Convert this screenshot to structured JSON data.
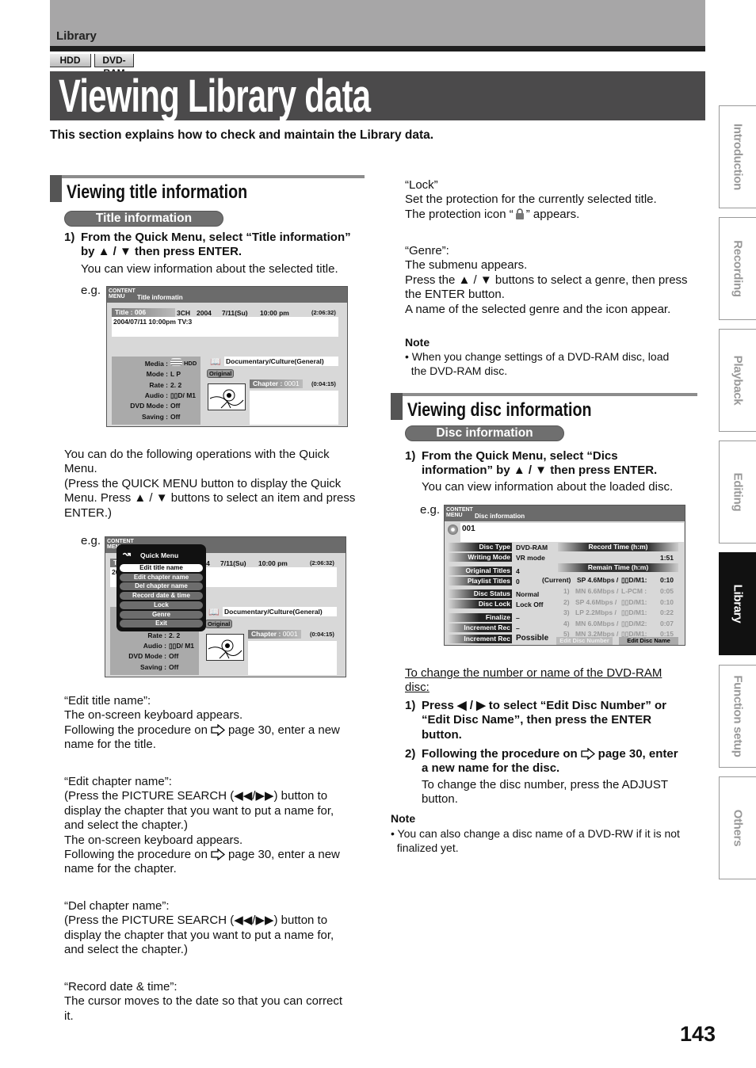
{
  "header": {
    "section": "Library",
    "badges": [
      "HDD",
      "DVD-RAM"
    ],
    "title": "Viewing Library data",
    "intro": "This section explains how to check and maintain the Library data."
  },
  "side_tabs": [
    "Introduction",
    "Recording",
    "Playback",
    "Editing",
    "Library",
    "Function setup",
    "Others"
  ],
  "active_tab": "Library",
  "page_number": "143",
  "left": {
    "section_title": "Viewing title information",
    "pill": "Title information",
    "step1": {
      "num": "1)",
      "lines": [
        "From the Quick Menu, select “Title information”",
        "by ▲ / ▼ then press ENTER."
      ]
    },
    "step1_desc": "You can view information about the selected title.",
    "eg": "e.g.",
    "quick_para": [
      "You can do the following operations with the Quick",
      "Menu.",
      "(Press the QUICK MENU button to display the Quick",
      "Menu. Press ▲ / ▼ buttons to select an item and press",
      "ENTER.)"
    ],
    "eg2": "e.g.",
    "edit_title": [
      "“Edit title name”:",
      "The on-screen keyboard appears.",
      [
        "Following the procedure on",
        "page 30, enter a new"
      ],
      "name for the title."
    ],
    "edit_chapter": [
      "“Edit chapter name”:",
      "(Press the PICTURE SEARCH (◀◀/▶▶) button to",
      "display the chapter that you want to put a name for,",
      "and select the chapter.)",
      "The on-screen keyboard appears.",
      [
        "Following the procedure on",
        "page 30, enter a new"
      ],
      "name for the chapter."
    ],
    "del_chapter": [
      "“Del chapter name”:",
      "(Press the PICTURE SEARCH (◀◀/▶▶) button to",
      "display the chapter that you want to put a name for,",
      "and select the chapter.)"
    ],
    "record_date": [
      "“Record date & time”:",
      "The cursor moves to the date so that you can correct",
      "it."
    ]
  },
  "screen1": {
    "logo": [
      "CONTENT",
      "MENU"
    ],
    "header": "Title informatin",
    "title_label": "Title : 006",
    "channel": "3CH",
    "year": "2004",
    "date": "7/11(Su)",
    "time": "10:00 pm",
    "duration": "(2:06:32)",
    "title_name": "2004/07/11  10:00pm  TV:3",
    "info": [
      {
        "label": "Media :",
        "value": "HDD"
      },
      {
        "label": "Mode :",
        "value": "L P"
      },
      {
        "label": "Rate :",
        "value": "2. 2"
      },
      {
        "label": "Audio :",
        "value": "▯▯D/ M1"
      },
      {
        "label": "DVD Mode :",
        "value": "Off"
      },
      {
        "label": "Saving :",
        "value": "Off"
      }
    ],
    "genre": "Documentary/Culture(General)",
    "original": "Original",
    "chapter_label": "Chapter :",
    "chapter_num": "0001",
    "chapter_time": "(0:04:15)"
  },
  "quick_menu": {
    "title": "Quick Menu",
    "items": [
      "Edit title name",
      "Edit chapter name",
      "Del chapter name",
      "Record date & time",
      "Lock",
      "Genre",
      "Exit"
    ],
    "selected": "Edit title name"
  },
  "right": {
    "lock": [
      "“Lock”",
      "Set the protection for the currently selected title.",
      [
        "The protection icon “",
        "” appears."
      ]
    ],
    "genre": [
      "“Genre”:",
      "The submenu appears.",
      "Press the ▲ / ▼ buttons to select a genre, then press",
      "the ENTER button.",
      "A name of the selected genre and the icon appear."
    ],
    "note1_title": "Note",
    "note1": [
      "• When you change settings of a DVD-RAM disc, load",
      "  the DVD-RAM disc."
    ],
    "section_title": "Viewing disc information",
    "pill": "Disc information",
    "step1": {
      "num": "1)",
      "lines": [
        "From the Quick Menu, select “Dics",
        "information” by ▲ / ▼ then press ENTER."
      ]
    },
    "step1_desc": "You can view information about the loaded disc.",
    "eg": "e.g.",
    "change_heading": [
      "To change the number or name of the DVD-RAM",
      "disc:"
    ],
    "step_a": {
      "num": "1)",
      "lines": [
        "Press ◀ / ▶ to select “Edit Disc Number” or",
        "“Edit Disc Name”, then press the ENTER",
        "button."
      ]
    },
    "step_b": {
      "num": "2)",
      "lines": [
        [
          "Following the procedure on",
          "page 30, enter"
        ],
        "a new name for the disc."
      ]
    },
    "step_b_desc": [
      "To change the disc number, press the ADJUST",
      "button."
    ],
    "note2_title": "Note",
    "note2": [
      "• You can also change a disc name of a DVD-RW if it is not",
      "  finalized yet."
    ]
  },
  "screen3": {
    "logo": [
      "CONTENT",
      "MENU"
    ],
    "header": "Disc information",
    "disc_num": "001",
    "labels": [
      "Disc Type",
      "Writing Mode",
      "Original Titles",
      "Playlist Titles",
      "Disc Status",
      "Disc Lock",
      "Finalize",
      "Increment Rec",
      "Increment Rec"
    ],
    "values": [
      "DVD-RAM",
      "VR mode",
      "4",
      "0",
      "Normal",
      "Lock Off",
      "–",
      "–",
      "Possible"
    ],
    "record_time_label": "Record Time (h:m)",
    "record_time": "1:51",
    "remain_label": "Remain Time (h:m)",
    "current": {
      "tag": "(Current)",
      "rate": "SP 4.6Mbps /",
      "audio": "▯▯D/M1:",
      "time": "0:10"
    },
    "modes": [
      {
        "n": "1)",
        "rate": "MN 6.6Mbps /",
        "audio": "L-PCM  :",
        "time": "0:05"
      },
      {
        "n": "2)",
        "rate": "SP 4.6Mbps /",
        "audio": "▯▯D/M1:",
        "time": "0:10"
      },
      {
        "n": "3)",
        "rate": "LP 2.2Mbps /",
        "audio": "▯▯D/M1:",
        "time": "0:22"
      },
      {
        "n": "4)",
        "rate": "MN 6.0Mbps /",
        "audio": "▯▯D/M2:",
        "time": "0:07"
      },
      {
        "n": "5)",
        "rate": "MN 3.2Mbps /",
        "audio": "▯▯D/M1:",
        "time": "0:15"
      }
    ],
    "btn_number": "Edit Disc Number",
    "btn_name": "Edit Disc Name"
  }
}
